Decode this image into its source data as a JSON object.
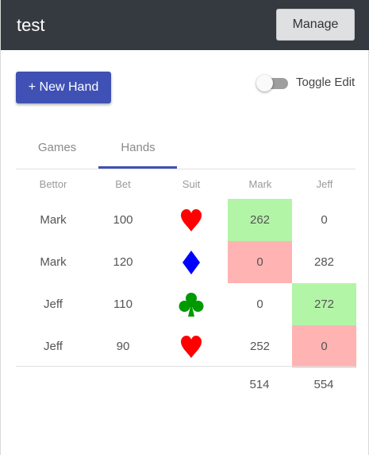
{
  "header": {
    "title": "test",
    "manage_label": "Manage"
  },
  "actions": {
    "new_hand_label": "+ New Hand",
    "toggle_label": "Toggle Edit",
    "toggle_on": false
  },
  "tabs": [
    {
      "label": "Games",
      "active": false
    },
    {
      "label": "Hands",
      "active": true
    }
  ],
  "table": {
    "headers": [
      "Bettor",
      "Bet",
      "Suit",
      "Mark",
      "Jeff"
    ],
    "rows": [
      {
        "bettor": "Mark",
        "bet": "100",
        "suit": "heart-icon",
        "suit_color": "#ff0000",
        "mark": "262",
        "jeff": "0",
        "mark_status": "win",
        "jeff_status": ""
      },
      {
        "bettor": "Mark",
        "bet": "120",
        "suit": "diamond-icon",
        "suit_color": "#0000ff",
        "mark": "0",
        "jeff": "282",
        "mark_status": "lose",
        "jeff_status": ""
      },
      {
        "bettor": "Jeff",
        "bet": "110",
        "suit": "club-icon",
        "suit_color": "#009900",
        "mark": "0",
        "jeff": "272",
        "mark_status": "",
        "jeff_status": "win"
      },
      {
        "bettor": "Jeff",
        "bet": "90",
        "suit": "heart-icon",
        "suit_color": "#ff0000",
        "mark": "252",
        "jeff": "0",
        "mark_status": "",
        "jeff_status": "lose"
      }
    ],
    "totals": {
      "mark": "514",
      "jeff": "554"
    }
  },
  "colors": {
    "topbar": "#353a40",
    "accent": "#3f51b5",
    "win": "#b3f5a7",
    "lose": "#ffb3b3"
  }
}
